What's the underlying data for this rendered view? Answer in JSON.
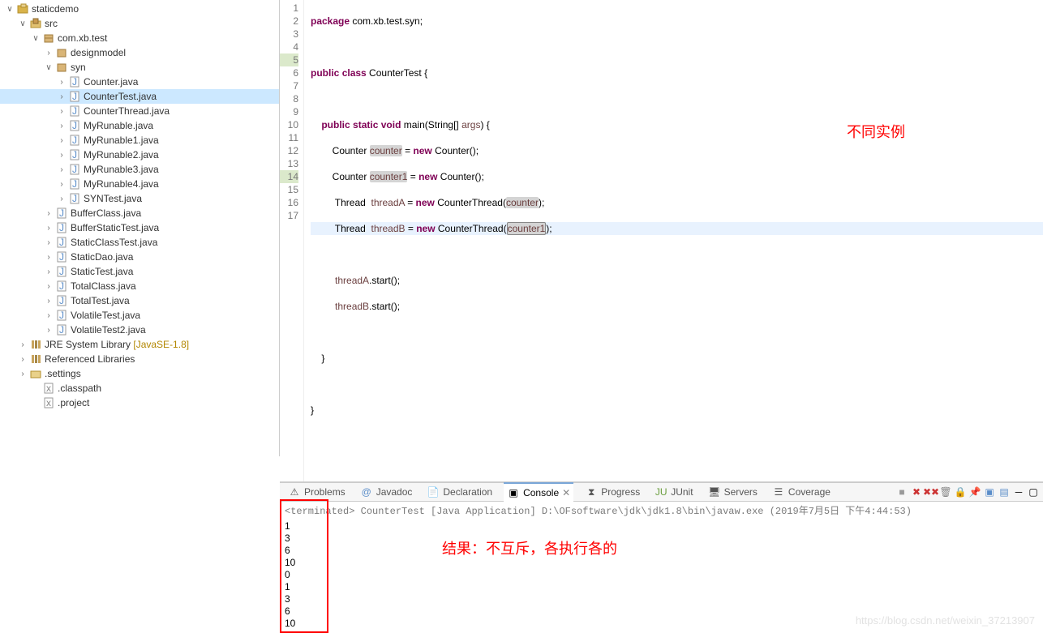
{
  "tree": {
    "project": "staticdemo",
    "src": "src",
    "pkg": "com.xb.test",
    "designmodel": "designmodel",
    "syn": "syn",
    "files": {
      "counter": "Counter.java",
      "countertest": "CounterTest.java",
      "counterthread": "CounterThread.java",
      "myrunable": "MyRunable.java",
      "myrunable1": "MyRunable1.java",
      "myrunable2": "MyRunable2.java",
      "myrunable3": "MyRunable3.java",
      "myrunable4": "MyRunable4.java",
      "syntest": "SYNTest.java"
    },
    "top_files": {
      "bufferclass": "BufferClass.java",
      "bufferstatic": "BufferStaticTest.java",
      "staticclass": "StaticClassTest.java",
      "staticdao": "StaticDao.java",
      "statictest": "StaticTest.java",
      "totalclass": "TotalClass.java",
      "totaltest": "TotalTest.java",
      "volatiletest": "VolatileTest.java",
      "volatiletest2": "VolatileTest2.java"
    },
    "jre": "JRE System Library",
    "jre_ver": "[JavaSE-1.8]",
    "reflib": "Referenced Libraries",
    "settings": ".settings",
    "classpath": ".classpath",
    "projectfile": ".project"
  },
  "code": {
    "l1a": "package",
    "l1b": " com.xb.test.syn;",
    "l3a": "public",
    "l3b": "class",
    "l3c": " CounterTest {",
    "l5a": "public",
    "l5b": "static",
    "l5c": "void",
    "l5d": " main(String[] ",
    "l5e": "args",
    "l5f": ") {",
    "l6a": "Counter ",
    "l6b": "counter",
    "l6c": " = ",
    "l6d": "new",
    "l6e": " Counter();",
    "l7a": "Counter ",
    "l7b": "counter1",
    "l7c": " = ",
    "l7d": "new",
    "l7e": " Counter();",
    "l8a": " Thread  ",
    "l8b": "threadA",
    "l8c": " = ",
    "l8d": "new",
    "l8e": " CounterThread(",
    "l8f": "counter",
    "l8g": ");",
    "l9a": " Thread  ",
    "l9b": "threadB",
    "l9c": " = ",
    "l9d": "new",
    "l9e": " CounterThread(",
    "l9f": "counter1",
    "l9g": ");",
    "l11a": "threadA",
    "l11b": ".start();",
    "l12a": "threadB",
    "l12b": ".start();",
    "l14a": "}",
    "l16a": "}"
  },
  "anno1": "不同实例",
  "tabs": {
    "problems": "Problems",
    "javadoc": "Javadoc",
    "declaration": "Declaration",
    "console": "Console",
    "progress": "Progress",
    "junit": "JUnit",
    "servers": "Servers",
    "coverage": "Coverage"
  },
  "terminated": "<terminated> CounterTest [Java Application] D:\\OFsoftware\\jdk\\jdk1.8\\bin\\javaw.exe (2019年7月5日 下午4:44:53)",
  "console_output": [
    "1",
    "3",
    "6",
    "10",
    "0",
    "1",
    "3",
    "6",
    "10"
  ],
  "anno2": "结果：不互斥，各执行各的",
  "watermark": "https://blog.csdn.net/weixin_37213907",
  "gutter_lines": [
    "1",
    "2",
    "3",
    "4",
    "5",
    "6",
    "7",
    "8",
    "9",
    "10",
    "11",
    "12",
    "13",
    "14",
    "15",
    "16",
    "17"
  ]
}
